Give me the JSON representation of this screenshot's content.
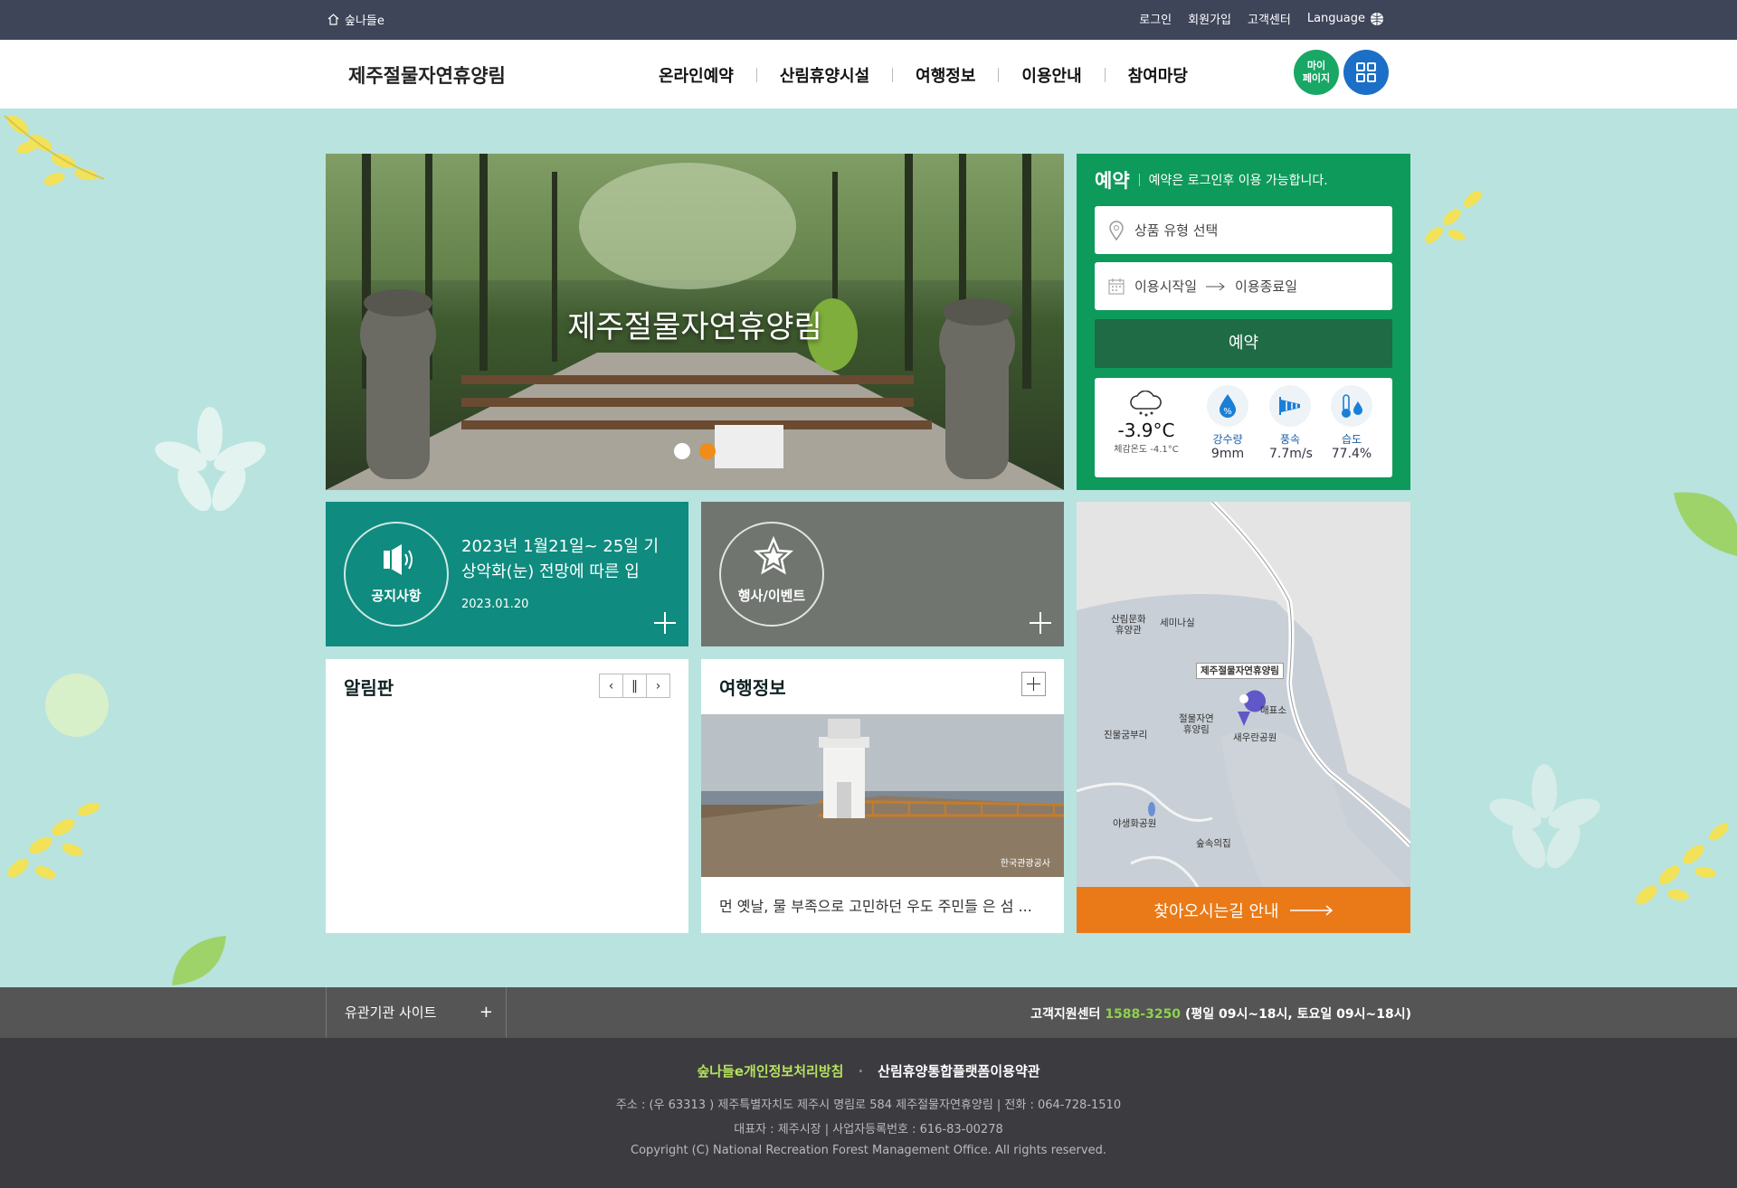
{
  "topbar": {
    "home": "숲나들e",
    "login": "로그인",
    "join": "회원가입",
    "cs": "고객센터",
    "language": "Language"
  },
  "header": {
    "logo": "제주절물자연휴양림",
    "nav": [
      "온라인예약",
      "산림휴양시설",
      "여행정보",
      "이용안내",
      "참여마당"
    ],
    "mypage": "마이\n페이지"
  },
  "hero": {
    "title": "제주절물자연휴양림",
    "slides": 2,
    "active_slide": 2
  },
  "reservation": {
    "title": "예약",
    "notice": "예약은 로그인후 이용 가능합니다.",
    "type_placeholder": "상품 유형 선택",
    "start": "이용시작일",
    "end": "이용종료일",
    "button": "예약"
  },
  "weather": {
    "temp": "-3.9°C",
    "feels": "체감온도 -4.1°C",
    "precip_label": "강수량",
    "precip": "9mm",
    "wind_label": "풍속",
    "wind": "7.7m/s",
    "humid_label": "습도",
    "humid": "77.4%"
  },
  "notice": {
    "label": "공지사항",
    "text": "2023년 1월21일~ 25일 기상악화(눈) 전망에 따른 입",
    "date": "2023.01.20"
  },
  "event": {
    "label": "행사/이벤트"
  },
  "board": {
    "title": "알림판"
  },
  "travel": {
    "title": "여행정보",
    "caption": "먼 옛날, 물 부족으로 고민하던 우도 주민들 은 섬 ...",
    "credit": "한국관광공사"
  },
  "map": {
    "labels": [
      "산림문화\n휴양관",
      "세미나실",
      "제주절물자연휴양림",
      "매표소",
      "절물자연\n휴양림",
      "진물굼부리",
      "새우란공원",
      "야생화공원",
      "숲속의집"
    ],
    "directions": "찾아오시는길 안내"
  },
  "footer": {
    "related": "유관기관 사이트",
    "cs_label": "고객지원센터",
    "cs_phone": "1588-3250",
    "cs_hours": "(평일 09시~18시, 토요일 09시~18시)",
    "privacy": "숲나들e개인정보처리방침",
    "terms": "산림휴양통합플랫폼이용약관",
    "address": "주소 : (우 63313 ) 제주특별자치도 제주시 명림로 584 제주절물자연휴양림 | 전화 : 064-728-1510",
    "rep": "대표자 : 제주시장 | 사업자등록번호 : 616-83-00278",
    "copyright": "Copyright (C) National Recreation Forest Management Office. All rights reserved."
  },
  "colors": {
    "bg": "#b9e3df",
    "topbar": "#3e4559",
    "green": "#0e9a5b",
    "teal": "#0f8b7f",
    "orange": "#ea7a17",
    "gray": "#707570"
  }
}
